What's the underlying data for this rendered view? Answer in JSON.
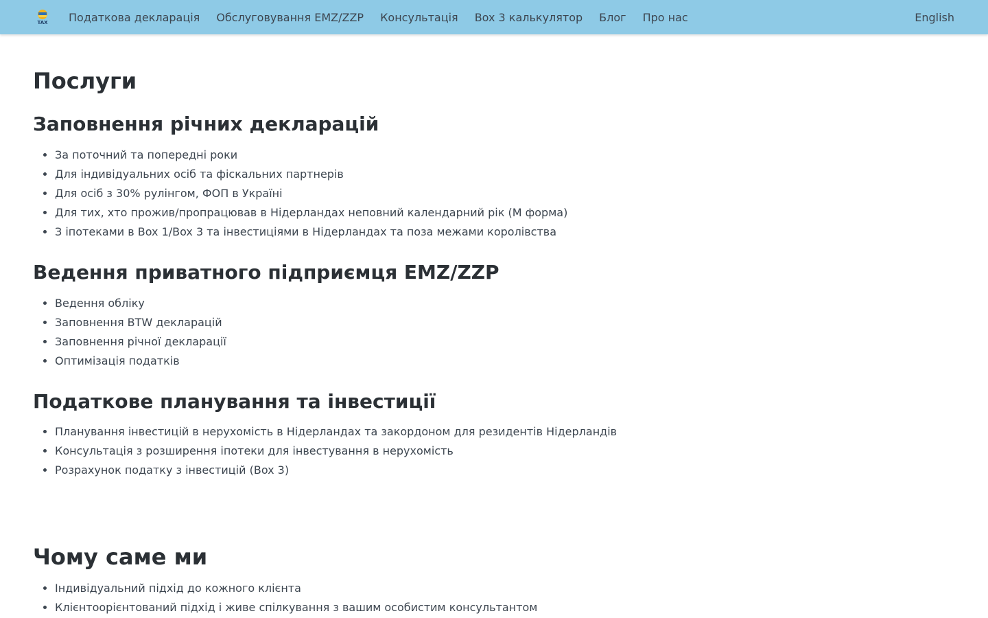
{
  "nav": {
    "logo_text": "TAX",
    "items": [
      {
        "label": "Податкова декларація"
      },
      {
        "label": "Обслуговування EMZ/ZZP"
      },
      {
        "label": "Консультація"
      },
      {
        "label": "Box 3 калькулятор"
      },
      {
        "label": "Блог"
      },
      {
        "label": "Про нас"
      }
    ],
    "language": "English"
  },
  "main": {
    "title": "Послуги",
    "sections": [
      {
        "heading": "Заповнення річних декларацій",
        "items": [
          "За поточний та попередні роки",
          "Для індивідуальних осіб та фіскальних партнерів",
          "Для осіб з 30% рулінгом, ФОП в Україні",
          "Для тих, хто прожив/пропрацював в Нідерландах неповний календарний рік (M форма)",
          "З іпотеками в Box 1/Box 3 та інвестиціями в Нідерландах та поза межами королівства"
        ]
      },
      {
        "heading": "Ведення приватного підприємця EMZ/ZZP",
        "items": [
          "Ведення обліку",
          "Заповнення BTW декларацій",
          "Заповнення річної декларації",
          "Оптимізація податків"
        ]
      },
      {
        "heading": "Податкове планування та інвестиції",
        "items": [
          "Планування інвестицій в нерухомість в Нідерландах та закордоном для резидентів Нідерландів",
          "Консультація з розширення іпотеки для інвестування в нерухомість",
          "Розрахунок податку з інвестицій (Box 3)"
        ]
      }
    ],
    "why": {
      "heading": "Чому саме ми",
      "items": [
        "Індивідуальний підхід до кожного клієнта",
        "Клієнтоорієнтований підхід і живе спілкування з вашим особистим консультантом"
      ]
    }
  },
  "colors": {
    "navbar": "#8ecae6",
    "text": "#2b3035"
  }
}
